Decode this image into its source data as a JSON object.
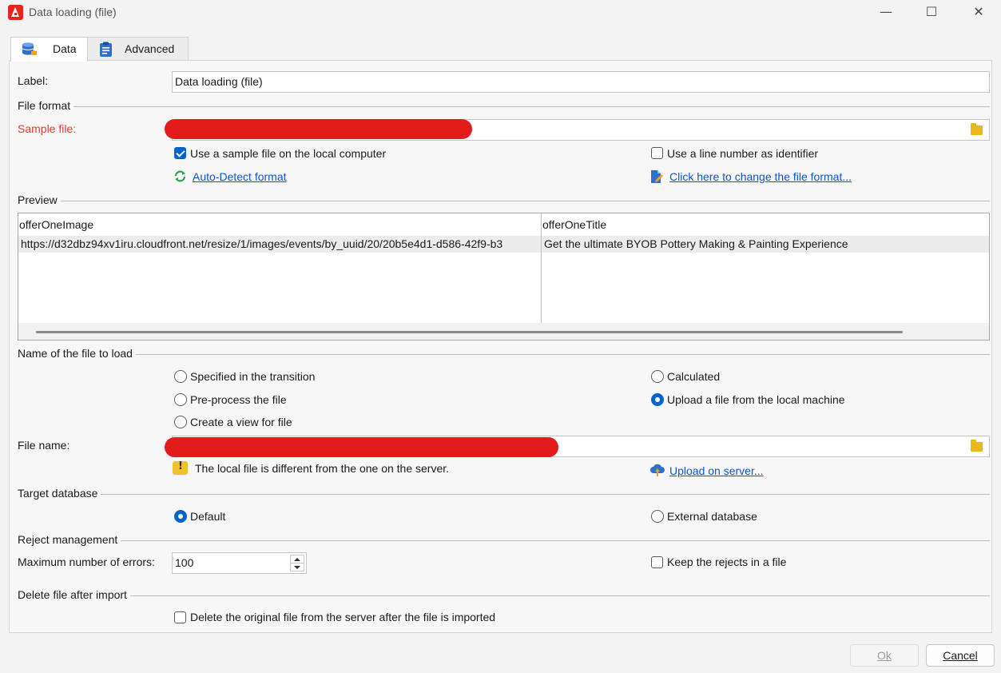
{
  "window": {
    "title": "Data loading (file)",
    "controls": {
      "minimize": "—",
      "maximize": "☐",
      "close": "✕"
    }
  },
  "tabs": [
    {
      "label": "Data",
      "icon": "database-icon",
      "active": true
    },
    {
      "label": "Advanced",
      "icon": "clipboard-icon",
      "active": false
    }
  ],
  "form": {
    "label_caption": "Label:",
    "label_value": "Data loading (file)",
    "file_format_section": "File format",
    "sample_file_caption": "Sample file:",
    "sample_file_value": "",
    "use_sample_file": {
      "label": "Use a sample file on the local computer",
      "checked": true
    },
    "use_line_number": {
      "label": "Use a line number as identifier",
      "checked": false
    },
    "auto_detect_link": "Auto-Detect format",
    "change_format_link": "Click here to change the file format...",
    "preview_section": "Preview",
    "preview": {
      "columns": [
        "offerOneImage",
        "offerOneTitle"
      ],
      "rows": [
        [
          "https://d32dbz94xv1iru.cloudfront.net/resize/1/images/events/by_uuid/20/20b5e4d1-d586-42f9-b3",
          "Get the ultimate BYOB Pottery Making & Painting Experience"
        ]
      ]
    },
    "file_to_load_section": "Name of the file to load",
    "options": {
      "specified_transition": {
        "label": "Specified in the transition",
        "selected": false
      },
      "calculated": {
        "label": "Calculated",
        "selected": false
      },
      "preprocess": {
        "label": "Pre-process the file",
        "selected": false
      },
      "upload_local": {
        "label": "Upload a file from the local machine",
        "selected": true
      },
      "create_view": {
        "label": "Create a view for file",
        "selected": false
      }
    },
    "file_name_caption": "File name:",
    "file_name_value": "",
    "warning_text": "The local file is different from the one on the server.",
    "upload_link": "Upload on server...",
    "target_db_section": "Target database",
    "target_default": {
      "label": "Default",
      "selected": true
    },
    "target_external": {
      "label": "External database",
      "selected": false
    },
    "reject_section": "Reject management",
    "max_errors_caption": "Maximum number of errors:",
    "max_errors_value": "100",
    "keep_rejects": {
      "label": "Keep the rejects in a file",
      "checked": false
    },
    "delete_section": "Delete file after import",
    "delete_original": {
      "label": "Delete the original file from the server after the file is imported",
      "checked": false
    }
  },
  "buttons": {
    "ok": "Ok",
    "cancel": "Cancel"
  },
  "colors": {
    "accent": "#0064c8",
    "required_label": "#e03a2f",
    "link": "#0b56c9",
    "redaction": "#e21b1b",
    "warning": "#f2c12e",
    "app_brand": "#e3281b"
  }
}
